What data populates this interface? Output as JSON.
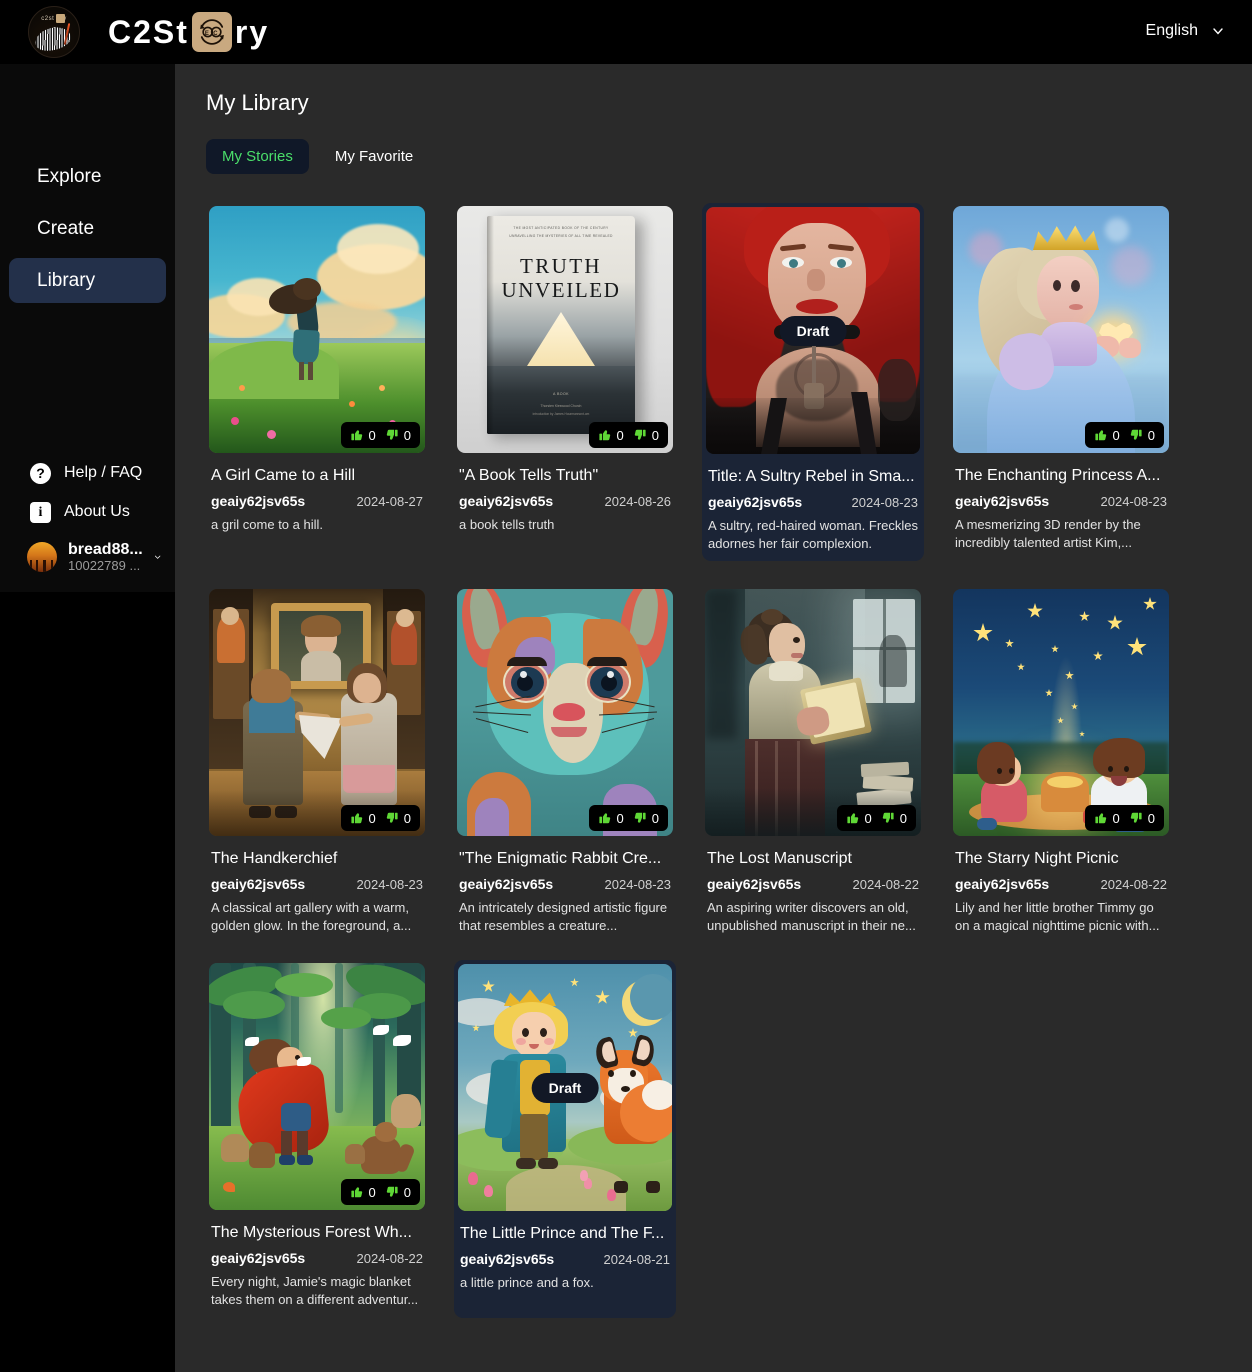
{
  "header": {
    "logo_text_pre": "C2St",
    "logo_text_post": "ry",
    "logo_icon_name": "recycle-icon",
    "language": "English"
  },
  "sidebar": {
    "nav": [
      {
        "label": "Explore",
        "active": false
      },
      {
        "label": "Create",
        "active": false
      },
      {
        "label": "Library",
        "active": true
      }
    ],
    "help": {
      "label": "Help / FAQ",
      "icon": "question-mark-icon",
      "glyph": "?"
    },
    "about": {
      "label": "About Us",
      "icon": "info-icon",
      "glyph": "i"
    },
    "user": {
      "name": "bread88...",
      "id": "10022789 ...",
      "chevron": "chevron-down-icon"
    }
  },
  "main": {
    "title": "My Library",
    "tabs": [
      {
        "label": "My Stories",
        "active": true
      },
      {
        "label": "My Favorite",
        "active": false
      }
    ]
  },
  "cards": [
    {
      "title": "A Girl Came to a Hill",
      "author": "geaiy62jsv65s",
      "date": "2024-08-27",
      "desc": "a gril come to a hill.",
      "likes": "0",
      "dislikes": "0",
      "draft": false,
      "scene": "girl-on-hill"
    },
    {
      "title": "\"A Book Tells Truth\"",
      "author": "geaiy62jsv65s",
      "date": "2024-08-26",
      "desc": "a book tells truth",
      "likes": "0",
      "dislikes": "0",
      "draft": false,
      "scene": "truth-unveiled-book",
      "book_title_line1": "TRUTH",
      "book_title_line2": "UNVEILED"
    },
    {
      "title": "Title: A Sultry Rebel in Sma...",
      "author": "geaiy62jsv65s",
      "date": "2024-08-23",
      "desc": "A sultry, red-haired woman. Freckles adornes her fair complexion. Sever...",
      "likes": null,
      "dislikes": null,
      "draft": true,
      "draft_label": "Draft",
      "scene": "redhead-portrait"
    },
    {
      "title": "The Enchanting Princess A...",
      "author": "geaiy62jsv65s",
      "date": "2024-08-23",
      "desc": "A mesmerizing 3D render by the incredibly talented artist Kim,...",
      "likes": "0",
      "dislikes": "0",
      "draft": false,
      "scene": "princess-heart"
    },
    {
      "title": "The Handkerchief",
      "author": "geaiy62jsv65s",
      "date": "2024-08-23",
      "desc": "A classical art gallery with a warm, golden glow. In the foreground, a...",
      "likes": "0",
      "dislikes": "0",
      "draft": false,
      "scene": "art-gallery-children"
    },
    {
      "title": "\"The Enigmatic Rabbit Cre...",
      "author": "geaiy62jsv65s",
      "date": "2024-08-23",
      "desc": "An intricately designed artistic figure that resembles a creature...",
      "likes": "0",
      "dislikes": "0",
      "draft": false,
      "scene": "patchwork-rabbit"
    },
    {
      "title": "The Lost Manuscript",
      "author": "geaiy62jsv65s",
      "date": "2024-08-22",
      "desc": "An aspiring writer discovers an old, unpublished manuscript in their ne...",
      "likes": "0",
      "dislikes": "0",
      "draft": false,
      "scene": "woman-reading-manuscript"
    },
    {
      "title": "The Starry Night Picnic",
      "author": "geaiy62jsv65s",
      "date": "2024-08-22",
      "desc": "Lily and her little brother Timmy go on a magical nighttime picnic with...",
      "likes": "0",
      "dislikes": "0",
      "draft": false,
      "scene": "starry-picnic"
    },
    {
      "title": "The Mysterious Forest Wh...",
      "author": "geaiy62jsv65s",
      "date": "2024-08-22",
      "desc": "Every night, Jamie's magic blanket takes them on a different adventur...",
      "likes": "0",
      "dislikes": "0",
      "draft": false,
      "scene": "forest-red-cape"
    },
    {
      "title": "The Little Prince and The F...",
      "author": "geaiy62jsv65s",
      "date": "2024-08-21",
      "desc": "a little prince and a fox.",
      "likes": null,
      "dislikes": null,
      "draft": true,
      "draft_label": "Draft",
      "scene": "little-prince-fox"
    }
  ],
  "colors": {
    "accent_green": "#4ade6a",
    "sidebar_bg": "#0a0a0a",
    "main_bg": "#2a2a2a",
    "active_nav": "#23304a",
    "draft_card_bg": "#1b2436"
  }
}
